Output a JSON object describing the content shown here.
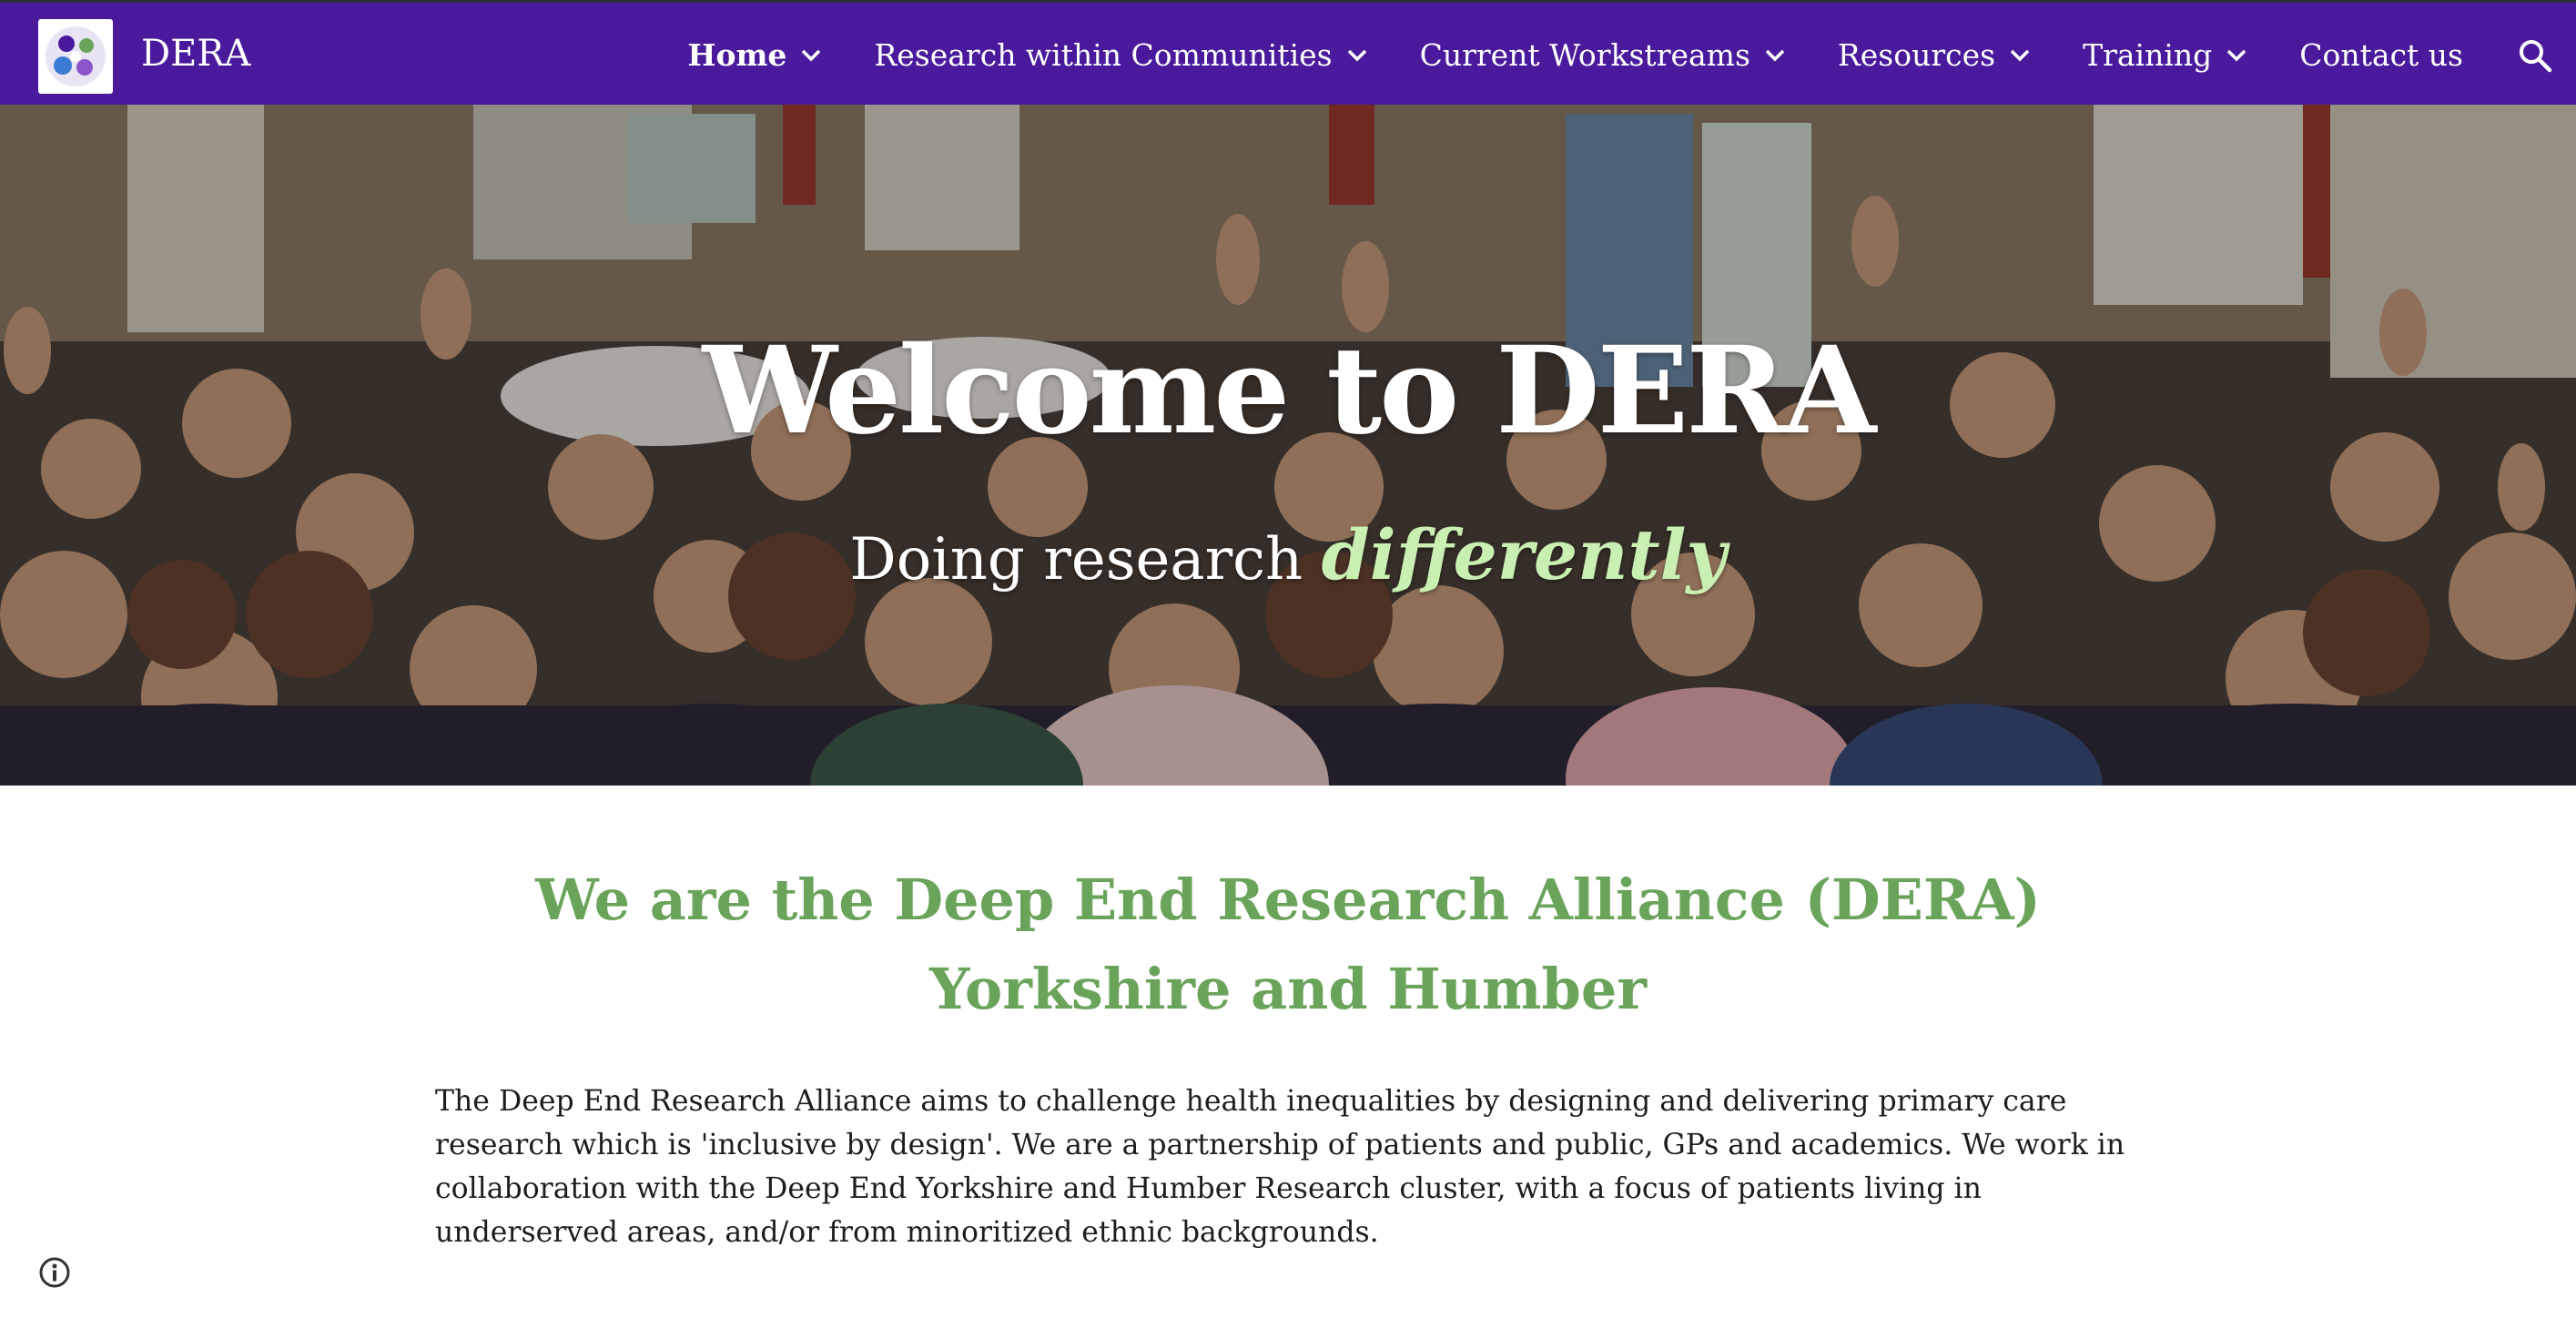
{
  "site": {
    "title": "DERA",
    "logo_icon": "dera-logo-icon"
  },
  "nav": {
    "items": [
      {
        "label": "Home",
        "active": true,
        "has_dropdown": true
      },
      {
        "label": "Research within Communities",
        "active": false,
        "has_dropdown": true
      },
      {
        "label": "Current Workstreams",
        "active": false,
        "has_dropdown": true
      },
      {
        "label": "Resources",
        "active": false,
        "has_dropdown": true
      },
      {
        "label": "Training",
        "active": false,
        "has_dropdown": true
      },
      {
        "label": "Contact us",
        "active": false,
        "has_dropdown": false
      }
    ],
    "search_icon": "search-icon"
  },
  "hero": {
    "title": "Welcome to DERA",
    "subtitle_prefix": "Doing research ",
    "subtitle_accent": "differently"
  },
  "main": {
    "heading": "We are the Deep End Research Alliance (DERA) Yorkshire and Humber",
    "intro": "The Deep End Research Alliance aims to challenge health inequalities by designing and delivering primary care research which is 'inclusive by design'. We are a partnership of patients and public, GPs and academics. We work in collaboration with the Deep End Yorkshire and Humber Research cluster, with a focus of patients living in underserved areas, and/or from minoritized ethnic backgrounds."
  },
  "footer": {
    "info_icon": "info-icon"
  },
  "colors": {
    "header_bg": "#4a1a9c",
    "heading_green": "#6aa35a",
    "accent_light_green": "#c9efb2"
  }
}
